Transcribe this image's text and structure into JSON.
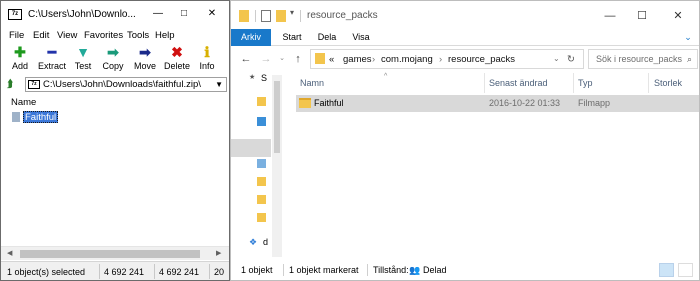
{
  "zip": {
    "title": "C:\\Users\\John\\Downlo...",
    "controls": [
      "—",
      "□",
      "✕"
    ],
    "menu": [
      "File",
      "Edit",
      "View",
      "Favorites",
      "Tools",
      "Help"
    ],
    "toolbar": [
      {
        "label": "Add",
        "icon": "plus-icon",
        "color": "#1e9a1e",
        "glyph": "✚"
      },
      {
        "label": "Extract",
        "icon": "minus-icon",
        "color": "#2233aa",
        "glyph": "━"
      },
      {
        "label": "Test",
        "icon": "check-icon",
        "color": "#22aa99",
        "glyph": "▼"
      },
      {
        "label": "Copy",
        "icon": "copy-arrow-icon",
        "color": "#1a9a7a",
        "glyph": "➡"
      },
      {
        "label": "Move",
        "icon": "move-arrow-icon",
        "color": "#1a2a8a",
        "glyph": "➡"
      },
      {
        "label": "Delete",
        "icon": "delete-icon",
        "color": "#d01010",
        "glyph": "✖"
      },
      {
        "label": "Info",
        "icon": "info-icon",
        "color": "#d8b000",
        "glyph": "ℹ"
      }
    ],
    "path": "C:\\Users\\John\\Downloads\\faithful.zip\\",
    "column_header": "Name",
    "items": [
      {
        "name": "Faithful",
        "selected": true
      }
    ],
    "status": [
      "1 object(s) selected",
      "4 692 241",
      "4 692 241",
      "20"
    ]
  },
  "explorer": {
    "title": "resource_packs",
    "controls": [
      "—",
      "☐",
      "✕"
    ],
    "ribbon_tabs": [
      "Arkiv",
      "Start",
      "Dela",
      "Visa"
    ],
    "breadcrumb": [
      "«",
      "games",
      "com.mojang",
      "resource_packs"
    ],
    "search_placeholder": "Sök i resource_packs",
    "nav_items": [
      "S",
      "d"
    ],
    "columns": [
      "Namn",
      "Senast ändrad",
      "Typ",
      "Storlek"
    ],
    "rows": [
      {
        "name": "Faithful",
        "modified": "2016-10-22 01:33",
        "type": "Filmapp"
      }
    ],
    "status": {
      "count": "1 objekt",
      "selected": "1 objekt markerat",
      "state_label": "Tillstånd:",
      "state_value": "Delad"
    },
    "accent": "#1979ca"
  }
}
